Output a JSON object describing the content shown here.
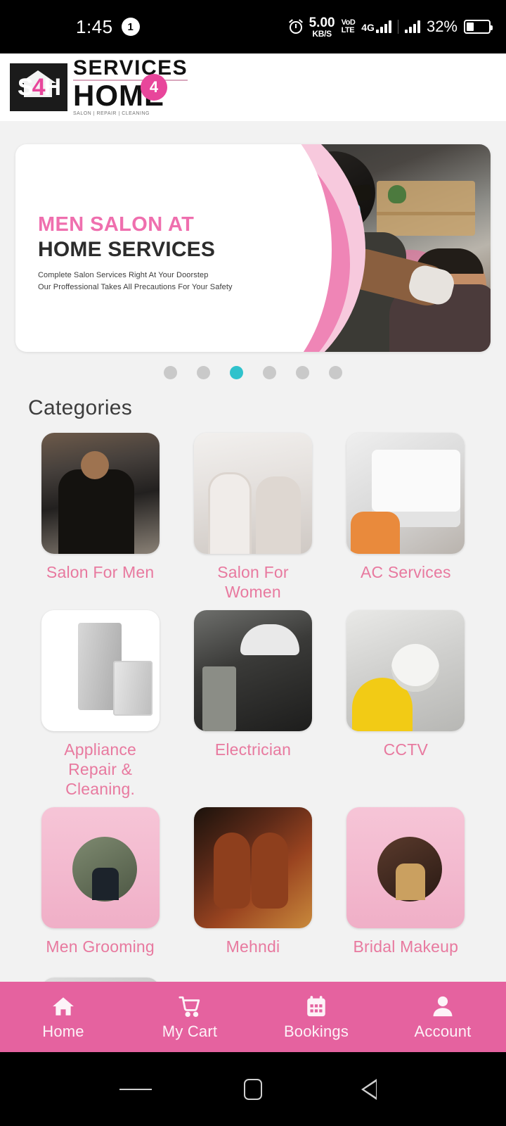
{
  "status_bar": {
    "time": "1:45",
    "notification_count": "1",
    "alarm_icon": "alarm-icon",
    "network_speed_value": "5.00",
    "network_speed_unit": "KB/S",
    "volte_line1": "VoD",
    "volte_line2": "LTE",
    "network_type": "4G",
    "battery_percent": "32%"
  },
  "header": {
    "logo_mark_s": "S",
    "logo_mark_4": "4",
    "logo_mark_h": "H",
    "brand_line1": "SERVICES",
    "brand_badge": "4",
    "brand_line2": "HOME",
    "brand_tagline": "SALON | REPAIR | CLEANING"
  },
  "banner": {
    "title_pink": "MEN SALON AT",
    "title_dark": "HOME SERVICES",
    "subtitle_line1": "Complete Salon Services Right  At Your Doorstep",
    "subtitle_line2": "Our Proffessional Takes All Precautions For Your Safety",
    "dots_total": 6,
    "active_dot_index": 2
  },
  "categories": {
    "section_title": "Categories",
    "items": [
      {
        "label": "Salon For Men",
        "art": "im-salonmen",
        "icon": "salon-men-photo"
      },
      {
        "label": "Salon For Women",
        "art": "im-salonwomen",
        "icon": "salon-women-photo"
      },
      {
        "label": "AC Services",
        "art": "im-ac",
        "icon": "ac-service-photo"
      },
      {
        "label": "Appliance Repair & Cleaning.",
        "art": "im-appliance",
        "icon": "appliance-photo"
      },
      {
        "label": "Electrician",
        "art": "im-elec",
        "icon": "electrician-photo"
      },
      {
        "label": "CCTV",
        "art": "im-cctv",
        "icon": "cctv-photo"
      },
      {
        "label": "Men Grooming",
        "art": "im-mengroom",
        "icon": "men-grooming-photo"
      },
      {
        "label": "Mehndi",
        "art": "im-mehndi",
        "icon": "mehndi-photo"
      },
      {
        "label": "Bridal Makeup",
        "art": "im-bridal",
        "icon": "bridal-makeup-photo"
      }
    ],
    "next_row_partial": [
      {
        "label": "",
        "art": "im-cleaning",
        "icon": "cleaning-photo"
      }
    ]
  },
  "bottom_nav": {
    "background_color": "#e5629f",
    "items": [
      {
        "label": "Home",
        "icon": "home-icon"
      },
      {
        "label": "My Cart",
        "icon": "cart-icon"
      },
      {
        "label": "Bookings",
        "icon": "calendar-icon"
      },
      {
        "label": "Account",
        "icon": "person-icon"
      }
    ]
  },
  "system_nav": {
    "recents": "recents-icon",
    "home": "home-square-icon",
    "back": "back-triangle-icon"
  },
  "colors": {
    "brand_pink": "#e8469b",
    "nav_pink": "#e5629f",
    "label_pink": "#e8799f",
    "active_dot": "#2fc2cc",
    "page_bg": "#f2f2f2"
  }
}
